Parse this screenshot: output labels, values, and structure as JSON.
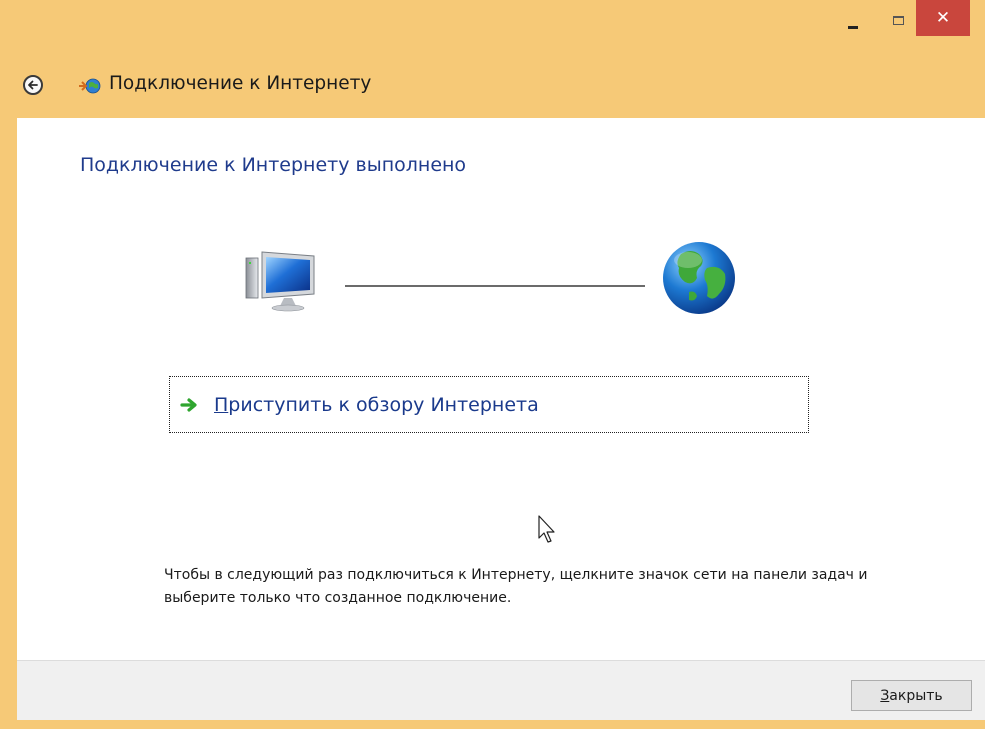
{
  "window": {
    "accent_color": "#f6c977",
    "close_color": "#c9463d",
    "controls": {
      "minimize_icon": "minimize-icon",
      "maximize_icon": "maximize-icon",
      "close_glyph": "✕"
    }
  },
  "nav": {
    "back_icon": "back-arrow-icon",
    "app_icon": "network-connection-icon",
    "title": "Подключение к Интернету"
  },
  "main": {
    "heading": "Подключение к Интернету выполнено",
    "connection": {
      "left_icon": "computer-icon",
      "right_icon": "globe-icon"
    },
    "browse_link": {
      "icon": "green-arrow-icon",
      "accel": "П",
      "label_rest": "риступить к обзору Интернета"
    },
    "hint": "Чтобы в следующий раз подключиться к Интернету, щелкните значок сети на панели задач и выберите только что созданное подключение."
  },
  "footer": {
    "close_accel": "З",
    "close_rest": "акрыть"
  }
}
